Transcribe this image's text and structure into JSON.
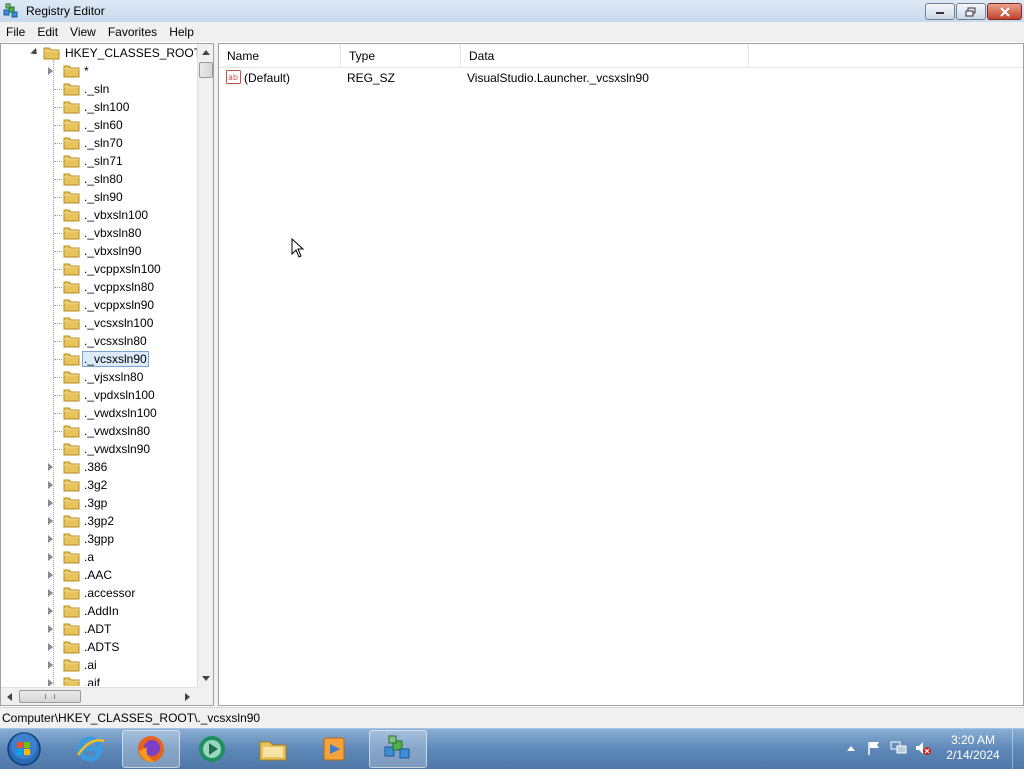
{
  "window": {
    "title": "Registry Editor"
  },
  "menu": [
    "File",
    "Edit",
    "View",
    "Favorites",
    "Help"
  ],
  "tree": {
    "root_label": "HKEY_CLASSES_ROOT",
    "items": [
      {
        "label": "*",
        "expandable": true
      },
      {
        "label": "._sln",
        "expandable": false
      },
      {
        "label": "._sln100",
        "expandable": false
      },
      {
        "label": "._sln60",
        "expandable": false
      },
      {
        "label": "._sln70",
        "expandable": false
      },
      {
        "label": "._sln71",
        "expandable": false
      },
      {
        "label": "._sln80",
        "expandable": false
      },
      {
        "label": "._sln90",
        "expandable": false
      },
      {
        "label": "._vbxsln100",
        "expandable": false
      },
      {
        "label": "._vbxsln80",
        "expandable": false
      },
      {
        "label": "._vbxsln90",
        "expandable": false
      },
      {
        "label": "._vcppxsln100",
        "expandable": false
      },
      {
        "label": "._vcppxsln80",
        "expandable": false
      },
      {
        "label": "._vcppxsln90",
        "expandable": false
      },
      {
        "label": "._vcsxsln100",
        "expandable": false
      },
      {
        "label": "._vcsxsln80",
        "expandable": false
      },
      {
        "label": "._vcsxsln90",
        "expandable": false,
        "selected": true
      },
      {
        "label": "._vjsxsln80",
        "expandable": false
      },
      {
        "label": "._vpdxsln100",
        "expandable": false
      },
      {
        "label": "._vwdxsln100",
        "expandable": false
      },
      {
        "label": "._vwdxsln80",
        "expandable": false
      },
      {
        "label": "._vwdxsln90",
        "expandable": false
      },
      {
        "label": ".386",
        "expandable": true
      },
      {
        "label": ".3g2",
        "expandable": true
      },
      {
        "label": ".3gp",
        "expandable": true
      },
      {
        "label": ".3gp2",
        "expandable": true
      },
      {
        "label": ".3gpp",
        "expandable": true
      },
      {
        "label": ".a",
        "expandable": true
      },
      {
        "label": ".AAC",
        "expandable": true
      },
      {
        "label": ".accessor",
        "expandable": true
      },
      {
        "label": ".AddIn",
        "expandable": true
      },
      {
        "label": ".ADT",
        "expandable": true
      },
      {
        "label": ".ADTS",
        "expandable": true
      },
      {
        "label": ".ai",
        "expandable": true
      },
      {
        "label": ".aif",
        "expandable": true
      }
    ]
  },
  "list": {
    "columns": {
      "name": "Name",
      "type": "Type",
      "data": "Data"
    },
    "rows": [
      {
        "name": "(Default)",
        "type": "REG_SZ",
        "data": "VisualStudio.Launcher._vcsxsln90"
      }
    ]
  },
  "status": {
    "path": "Computer\\HKEY_CLASSES_ROOT\\._vcsxsln90"
  },
  "taskbar": {
    "apps": [
      "internet-explorer-icon",
      "firefox-icon",
      "media-center-icon",
      "file-explorer-icon",
      "media-player-icon",
      "registry-editor-icon"
    ],
    "clock_time": "3:20 AM",
    "clock_date": "2/14/2024"
  }
}
